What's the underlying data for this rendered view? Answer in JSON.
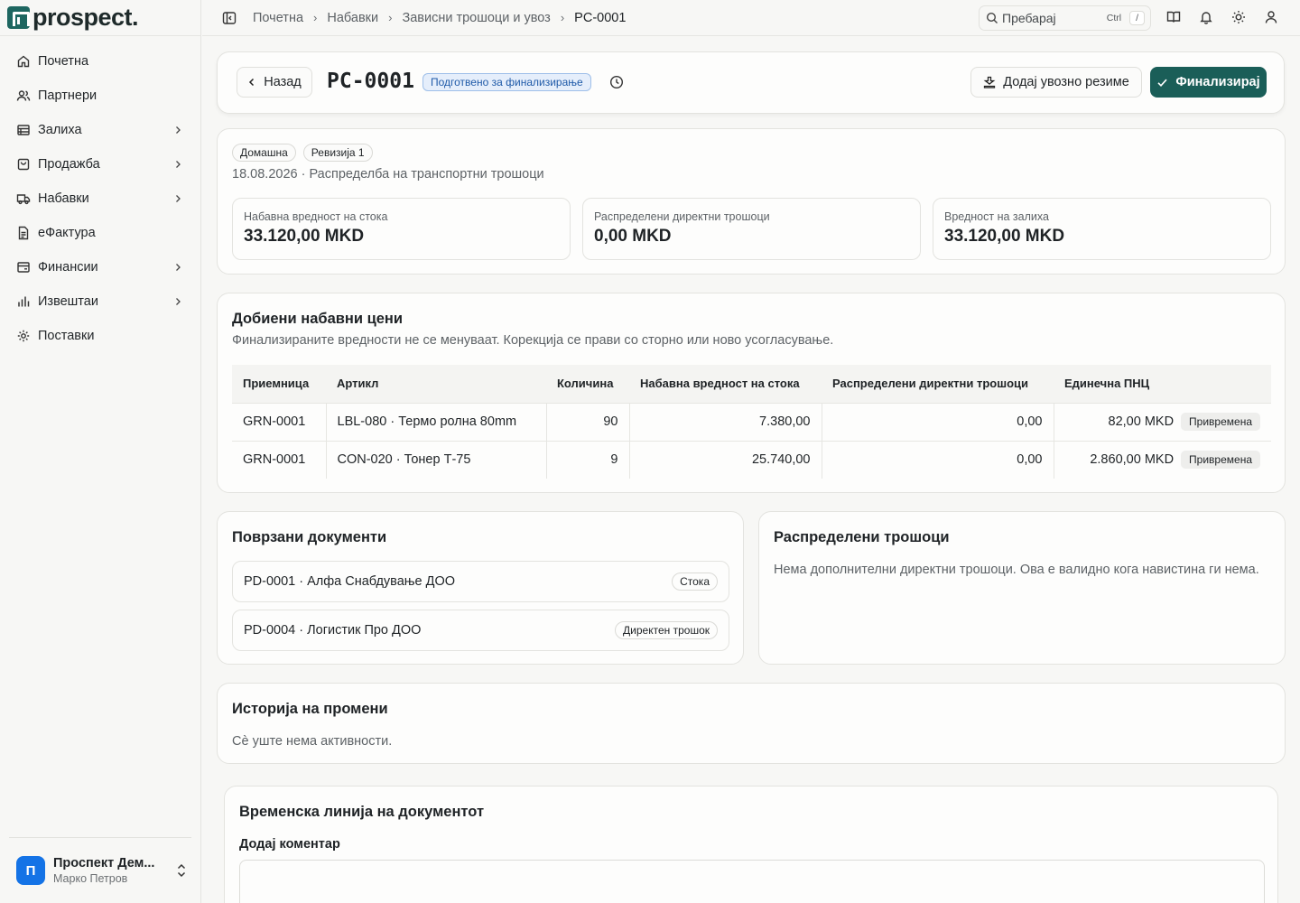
{
  "app": {
    "logo_text": "prospect."
  },
  "sidebar": {
    "items": [
      {
        "label": "Почетна",
        "icon": "home-icon",
        "chevron": false
      },
      {
        "label": "Партнери",
        "icon": "users-icon",
        "chevron": false
      },
      {
        "label": "Залиха",
        "icon": "inventory-icon",
        "chevron": true
      },
      {
        "label": "Продажба",
        "icon": "shopping-bag-icon",
        "chevron": true
      },
      {
        "label": "Набавки",
        "icon": "truck-icon",
        "chevron": true
      },
      {
        "label": "еФактура",
        "icon": "document-icon",
        "chevron": false
      },
      {
        "label": "Финансии",
        "icon": "wallet-icon",
        "chevron": true
      },
      {
        "label": "Извештаи",
        "icon": "bar-chart-icon",
        "chevron": true
      },
      {
        "label": "Поставки",
        "icon": "gear-icon",
        "chevron": false
      }
    ],
    "footer": {
      "avatar_letter": "П",
      "org_name": "Проспект Дем...",
      "user_name": "Марко Петров"
    }
  },
  "topbar": {
    "breadcrumbs": [
      "Почетна",
      "Набавки",
      "Зависни трошоци и увоз",
      "PC-0001"
    ],
    "search_placeholder": "Пребарај",
    "kbd_ctrl": "Ctrl",
    "kbd_slash": "/"
  },
  "header": {
    "back_label": "Назад",
    "doc_id": "PC-0001",
    "status": "Подготвено за финализирање",
    "import_label": "Додај увозно резиме",
    "finalize_label": "Финализирај"
  },
  "summary": {
    "tags": [
      "Домашна",
      "Ревизија 1"
    ],
    "subtitle": "18.08.2026 · Распределба на транспортни трошоци",
    "stats": [
      {
        "label": "Набавна вредност на стока",
        "value": "33.120,00 MKD"
      },
      {
        "label": "Распределени директни трошоци",
        "value": "0,00 MKD"
      },
      {
        "label": "Вредност на залиха",
        "value": "33.120,00 MKD"
      }
    ]
  },
  "prices": {
    "title": "Добиени набавни цени",
    "subtitle": "Финализираните вредности не се менуваат. Корекција се прави со сторно или ново усогласување.",
    "columns": [
      "Приемница",
      "Артикл",
      "Количина",
      "Набавна вредност на стока",
      "Распределени директни трошоци",
      "Единечна ПНЦ"
    ],
    "rows": [
      {
        "receipt": "GRN-0001",
        "article": "LBL-080 · Термо ролна 80mm",
        "qty": "90",
        "value": "7.380,00",
        "costs": "0,00",
        "unit": "82,00 MKD",
        "badge": "Привремена"
      },
      {
        "receipt": "GRN-0001",
        "article": "CON-020 · Тонер Т-75",
        "qty": "9",
        "value": "25.740,00",
        "costs": "0,00",
        "unit": "2.860,00 MKD",
        "badge": "Привремена"
      }
    ]
  },
  "linked": {
    "title": "Поврзани документи",
    "items": [
      {
        "label": "PD-0001 · Алфа Снабдување ДОО",
        "tag": "Стока"
      },
      {
        "label": "PD-0004 · Логистик Про ДОО",
        "tag": "Директен трошок"
      }
    ]
  },
  "costs": {
    "title": "Распределени трошоци",
    "text": "Нема дополнителни директни трошоци. Ова е валидно кога навистина ги нема."
  },
  "history": {
    "title": "Историја на промени",
    "text": "Сè уште нема активности."
  },
  "timeline": {
    "title": "Временска линија на документот",
    "comment_label": "Додај коментар"
  },
  "colors": {
    "brand": "#1a5e58",
    "status_bg": "#e5eefb",
    "status_text": "#1f5aa8",
    "avatar": "#1473e6"
  }
}
